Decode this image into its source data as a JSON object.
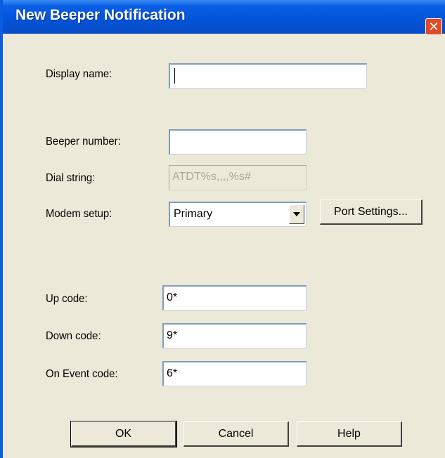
{
  "window": {
    "title": "New Beeper Notification",
    "close_glyph": "✕"
  },
  "fields": {
    "display_name": {
      "label": "Display name:",
      "value": ""
    },
    "beeper_number": {
      "label": "Beeper number:",
      "value": ""
    },
    "dial_string": {
      "label": "Dial string:",
      "value": "ATDT%s,,,,%s#"
    },
    "modem_setup": {
      "label": "Modem setup:",
      "value": "Primary"
    },
    "up_code": {
      "label": "Up code:",
      "value": "0*"
    },
    "down_code": {
      "label": "Down code:",
      "value": "9*"
    },
    "on_event_code": {
      "label": "On Event code:",
      "value": "6*"
    }
  },
  "buttons": {
    "port_settings": "Port Settings...",
    "ok": "OK",
    "cancel": "Cancel",
    "help": "Help"
  },
  "icons": {
    "close": "close-icon",
    "dropdown": "chevron-down-icon"
  },
  "colors": {
    "title_bar": "#0254D8",
    "close_button": "#E04A2A",
    "dialog_background": "#ECE9D8",
    "disabled_text": "#ACA899"
  }
}
